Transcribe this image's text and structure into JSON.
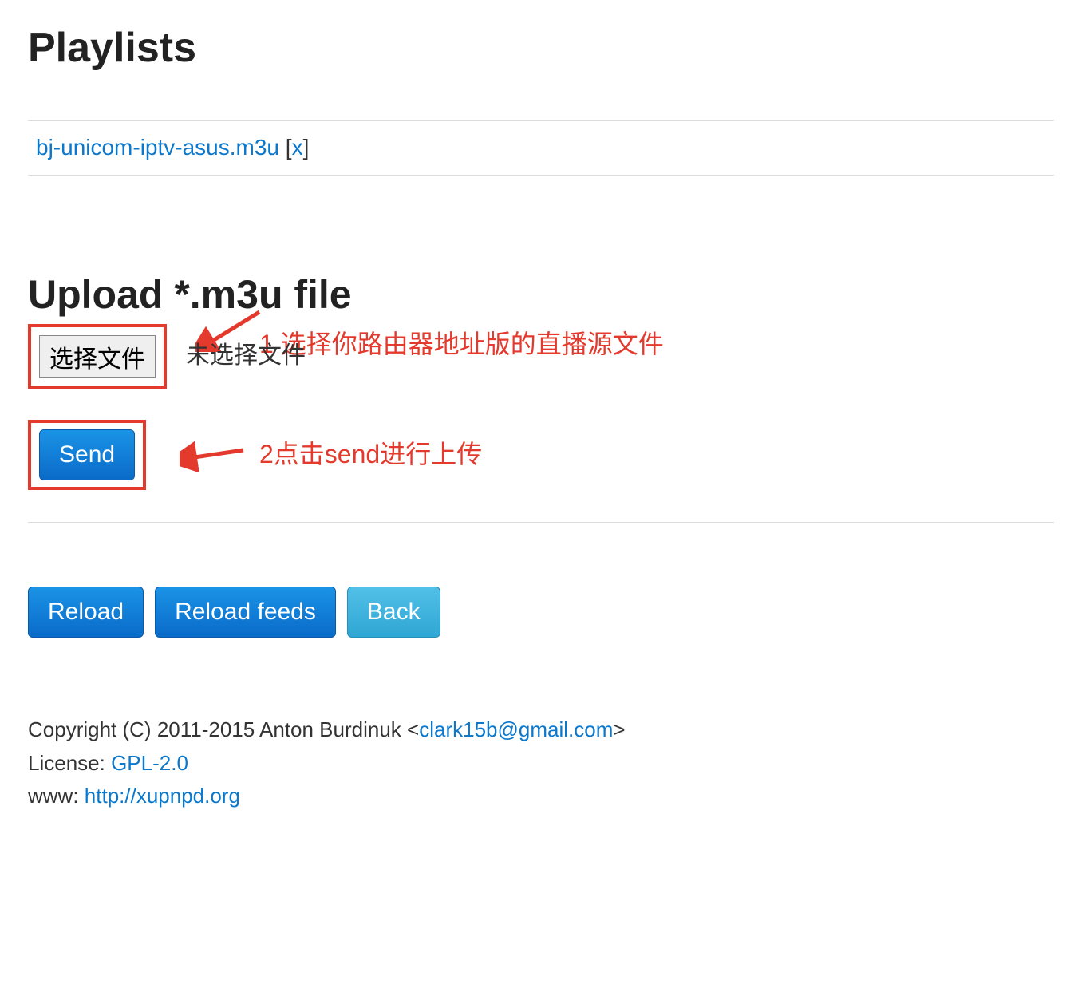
{
  "headings": {
    "playlists": "Playlists",
    "upload": "Upload *.m3u file"
  },
  "playlist": {
    "name": "bj-unicom-iptv-asus.m3u",
    "delete_open": " [",
    "delete_x": "x",
    "delete_close": "]"
  },
  "file_input": {
    "button_label": "选择文件",
    "status_text": "未选择文件"
  },
  "annotations": {
    "step1": "1 选择你路由器地址版的直播源文件",
    "step2": "2点击send进行上传"
  },
  "buttons": {
    "send": "Send",
    "reload": "Reload",
    "reload_feeds": "Reload feeds",
    "back": "Back"
  },
  "footer": {
    "copyright_prefix": "Copyright (C) 2011-2015 Anton Burdinuk <",
    "email": "clark15b@gmail.com",
    "copyright_suffix": ">",
    "license_prefix": "License: ",
    "license": "GPL-2.0",
    "www_prefix": "www: ",
    "www": "http://xupnpd.org"
  }
}
